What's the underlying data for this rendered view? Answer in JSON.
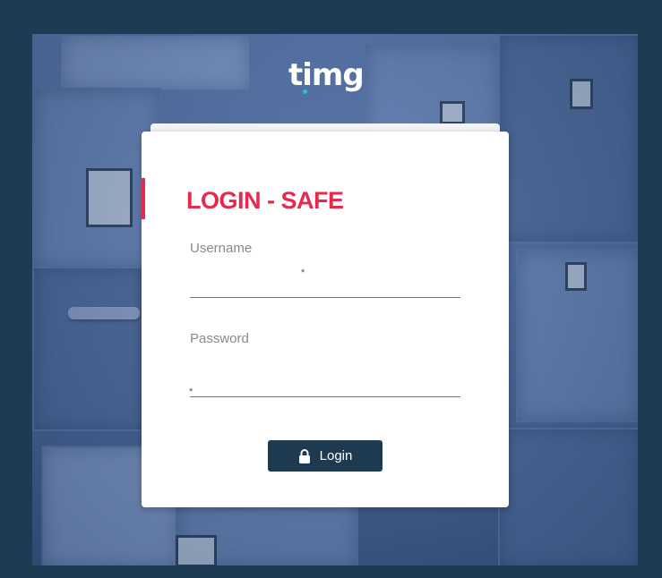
{
  "brand": {
    "logo_text": "timg",
    "accent_color": "#e32a4f",
    "logo_dot_color": "#2ec1c9",
    "frame_color": "#1d3b52"
  },
  "login": {
    "title": "LOGIN - SAFE",
    "username": {
      "label": "Username",
      "value": "",
      "required_marker": "*"
    },
    "password": {
      "label": "Password",
      "value": "",
      "required_marker": "*"
    },
    "submit": {
      "label": "Login",
      "icon": "lock-icon"
    }
  }
}
